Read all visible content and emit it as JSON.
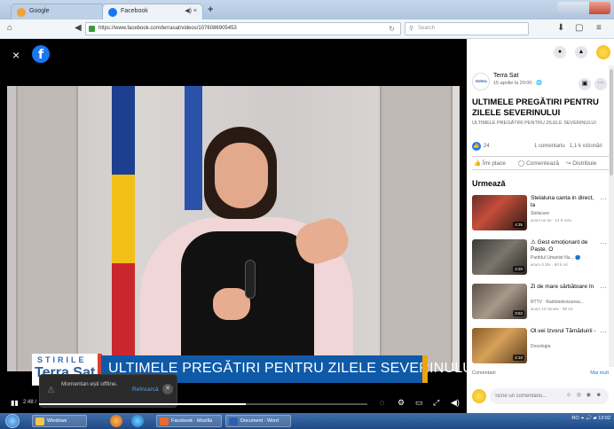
{
  "browser": {
    "tabs": [
      {
        "label": "Google"
      },
      {
        "label": "Facebook",
        "controls": "◀) ×"
      }
    ],
    "new_tab": "+",
    "url": "https://www.facebook.com/terrasat/videos/1076086905453",
    "search_placeholder": "Search",
    "nav_icons": [
      "home-icon",
      "back-icon",
      "forward-icon"
    ],
    "toolbar_icons": [
      "download-icon",
      "bookmarks-icon",
      "menu-icon"
    ]
  },
  "viewer": {
    "close": "×",
    "logo": "f",
    "lower_third": {
      "brand_top": "STIRILE",
      "brand_bottom": "Terra Sat",
      "headline": "ULTIMELE PREGĂTIRI PENTRU ZILELE SEVERINULUI"
    },
    "controls": {
      "play": "▮▮",
      "time": "2:48 /",
      "progress": 0.63
    },
    "toast": {
      "text": "Momentan ești offline.",
      "refresh": "Reîncarcă",
      "close": "✕"
    }
  },
  "panel": {
    "page_name": "Terra Sat",
    "date": "15 aprilie la 20:00 · 🌐",
    "title": "ULTIMELE PREGĂTIRI PENTRU ZILELE SEVERINULUI",
    "subtitle": "ULTIMELE PREGĂTIRI PENTRU ZILELE SEVERINULUI",
    "likes": "24",
    "comments": "1 comentariu",
    "views": "1,1 k vizionări",
    "actions": {
      "like": "Îmi place",
      "comment": "Comentează",
      "share": "Distribuie"
    },
    "up_next_label": "Urmează",
    "videos": [
      {
        "title": "Stelaluna canta in direct, la",
        "channel": "Stelacare",
        "meta": "acum un an · 12 K vizu",
        "duration": "4:35"
      },
      {
        "title": "⚠ Gest emoționant de Paște. O",
        "channel": "Partidul Umanist Nu... 🔵",
        "meta": "acum 3 zile · 60 k viz",
        "duration": "4:20"
      },
      {
        "title": "Zi de mare sărbătoare în",
        "channel": "RTTV · Radiotelevizunea...",
        "meta": "acum 13 minute · 98 viz",
        "duration": "3:52"
      },
      {
        "title": "Ol.vei Izvorul Tămăduirii -",
        "channel": "Doxologia",
        "meta": "",
        "duration": "2:10"
      }
    ],
    "comments_label": "Comentarii",
    "see_more": "Mai mult",
    "comment_placeholder": "Scrie un comentariu...",
    "comment_tools": "☺ ◎ ◉ ☻"
  },
  "taskbar": {
    "items": [
      {
        "label": "Windows"
      },
      {
        "label": "Facebook · Mozilla"
      },
      {
        "label": "Document - Word"
      }
    ],
    "tray": "RO ⏶ 🔊 ▰ 13:02"
  }
}
